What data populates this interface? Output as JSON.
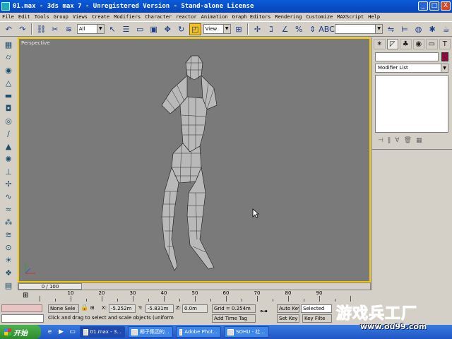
{
  "window": {
    "title": "01.max - 3ds max 7  - Unregistered Version - Stand-alone License",
    "controls": [
      "_",
      "□",
      "X"
    ]
  },
  "menu": [
    "File",
    "Edit",
    "Tools",
    "Group",
    "Views",
    "Create",
    "Modifiers",
    "Character",
    "reactor",
    "Animation",
    "Graph Editors",
    "Rendering",
    "Customize",
    "MAXScript",
    "Help"
  ],
  "toolbar": {
    "selection_filter": "All",
    "reference_coord": "View",
    "named_selection": ""
  },
  "viewport": {
    "label": "Perspective",
    "border_color": "#f0c800",
    "background": "#7a7a7a"
  },
  "command_panel": {
    "modifier_list": "Modifier List",
    "object_color": "#8b0a3a"
  },
  "timeline": {
    "slider_text": "0 / 100",
    "ruler_labels": [
      "10",
      "20",
      "30",
      "40",
      "50",
      "60",
      "70",
      "80",
      "90"
    ],
    "progress_fraction": 0.0
  },
  "status": {
    "selection_text": "None Sele",
    "x_label": "X:",
    "x_value": "-5.252m",
    "y_label": "Y:",
    "y_value": "-5.831m",
    "z_label": "Z:",
    "z_value": "0.0m",
    "grid": "Grid = 0.254m",
    "auto_key": "Auto Key",
    "selected": "Selected",
    "set_key": "Set Key",
    "key_filters": "Key Filte",
    "prompt": "Click and drag to select and scale objects (uniform",
    "add_time_tag": "Add Time Tag"
  },
  "taskbar": {
    "start_label": "开始",
    "tasks": [
      "01.max - 3...",
      "椰子集团的...",
      "Adobe Phot...",
      "SOHU - 社..."
    ],
    "active_index": 0
  },
  "watermark": {
    "title": "游戏兵工厂",
    "url": "www.ou99.com"
  }
}
